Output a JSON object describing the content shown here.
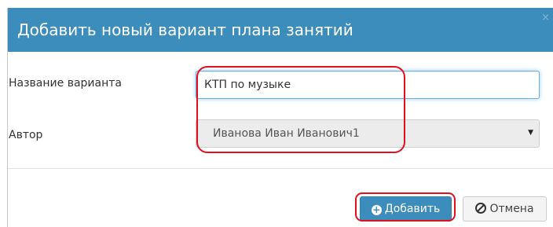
{
  "dialog": {
    "title": "Добавить новый вариант плана занятий",
    "close_icon": "close-icon",
    "close_glyph": "×"
  },
  "form": {
    "name_label": "Название варианта",
    "name_value": "КТП по музыке",
    "author_label": "Автор",
    "author_value": "Иванова Иван Иванович1",
    "author_arrow": "▼"
  },
  "footer": {
    "add_label": "Добавить",
    "add_icon": "plus-circle-icon",
    "cancel_label": "Отмена",
    "cancel_icon": "ban-icon"
  },
  "colors": {
    "header_bg": "#3c8dbc",
    "highlight": "#e0101e",
    "primary_button": "#3c8dbc"
  }
}
